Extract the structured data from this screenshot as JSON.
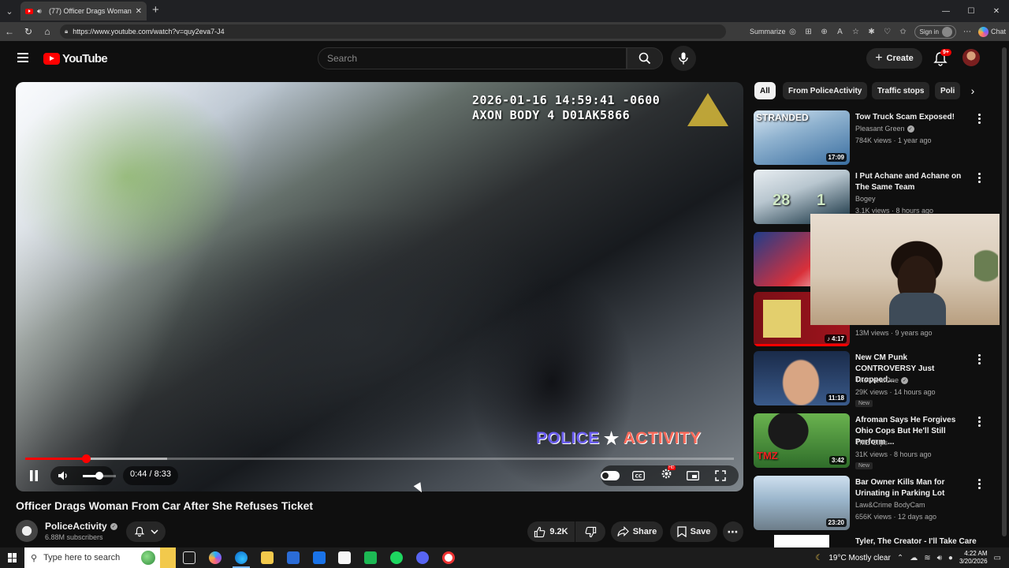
{
  "browser": {
    "tab_title": "(77) Officer Drags Woman Fro",
    "url": "https://www.youtube.com/watch?v=quy2eva7-J4",
    "summarize_label": "Summarize",
    "signin_label": "Sign in",
    "chat_label": "Chat"
  },
  "header": {
    "logo_text": "YouTube",
    "search_placeholder": "Search",
    "create_label": "Create",
    "notif_badge": "9+"
  },
  "player": {
    "timestamp_line1": "2026-01-16 14:59:41 -0600",
    "timestamp_line2": "AXON BODY 4 D01AK5866",
    "watermark_left": "POLICE",
    "watermark_right": "ACTIVITY",
    "time_display": "0:44 / 8:33",
    "progress_played_fraction": 0.086,
    "progress_buffered_fraction": 0.2,
    "volume_fraction": 0.5,
    "hd_badge": "HD"
  },
  "video": {
    "title": "Officer Drags Woman From Car After She Refuses Ticket",
    "channel": "PoliceActivity",
    "subscribers": "6.88M subscribers",
    "likes": "9.2K",
    "share_label": "Share",
    "save_label": "Save"
  },
  "chips": [
    "All",
    "From PoliceActivity",
    "Traffic stops",
    "Poli"
  ],
  "recommendations": [
    {
      "title": "Tow Truck Scam Exposed!",
      "channel": "Pleasant Green",
      "verified": true,
      "meta": "784K views · 1 year ago",
      "duration": "17:09",
      "thumb_text": "STRANDED",
      "new": false
    },
    {
      "title": "I Put Achane and Achane on The Same Team",
      "channel": "Bogey",
      "verified": false,
      "meta": "3.1K views · 8 hours ago",
      "duration": "",
      "thumb_text": "",
      "new": false
    },
    {
      "title": "",
      "channel": "",
      "verified": false,
      "meta": "",
      "duration": "",
      "thumb_text": "",
      "new": false
    },
    {
      "title": "",
      "channel": "",
      "verified": false,
      "meta": "13M views · 9 years ago",
      "duration": "4:17",
      "thumb_text": "",
      "new": false
    },
    {
      "title": "New CM Punk CONTROVERSY Just Dropped...",
      "channel": "TheGreatOne",
      "verified": true,
      "meta": "29K views · 14 hours ago",
      "duration": "11:18",
      "thumb_text": "",
      "new": true
    },
    {
      "title": "Afroman Says He Forgives Ohio Cops But He'll Still Perform ...",
      "channel": "TMZ Clips",
      "verified": false,
      "meta": "31K views · 8 hours ago",
      "duration": "3:42",
      "thumb_text": "TMZ",
      "new": true
    },
    {
      "title": "Bar Owner Kills Man for Urinating in Parking Lot",
      "channel": "Law&Crime BodyCam",
      "verified": false,
      "meta": "656K views · 12 days ago",
      "duration": "23:20",
      "thumb_text": "",
      "new": false
    },
    {
      "title": "Tyler, The Creator - I'll Take Care",
      "channel": "",
      "verified": false,
      "meta": "",
      "duration": "",
      "thumb_text": "",
      "new": false
    }
  ],
  "new_label": "New",
  "taskbar": {
    "search_placeholder": "Type here to search",
    "weather": "19°C  Mostly clear",
    "time": "4:22 AM",
    "date": "3/20/2026"
  },
  "colors": {
    "accent_red": "#ff0000",
    "bg": "#0f0f0f",
    "chip_bg": "#272727"
  }
}
